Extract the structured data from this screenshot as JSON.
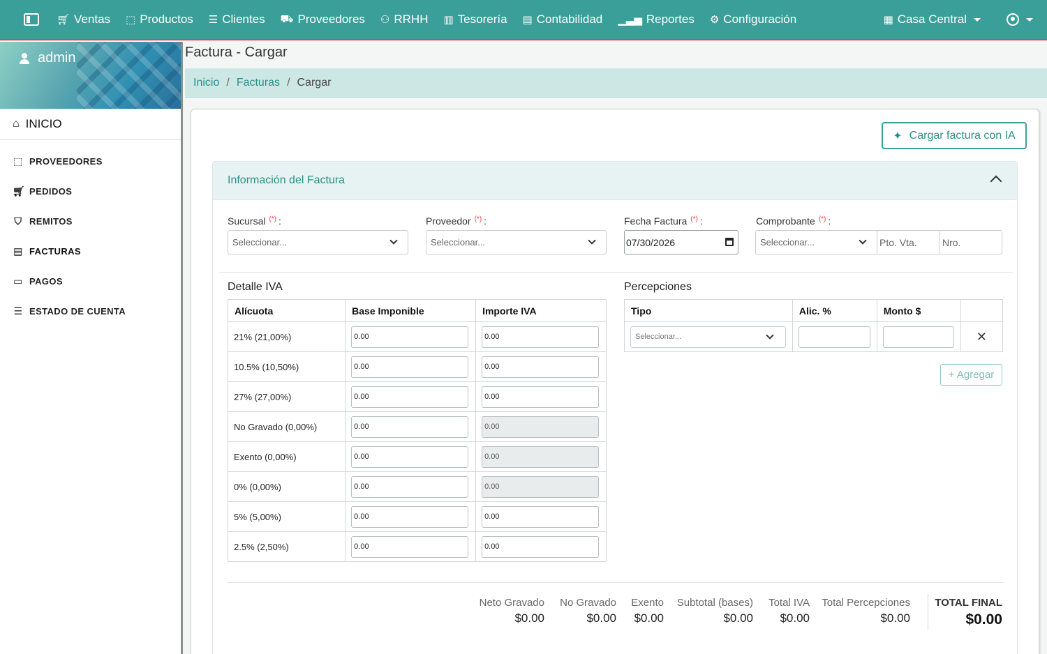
{
  "topnav": {
    "items": [
      {
        "icon": "cart-icon",
        "label": "Ventas"
      },
      {
        "icon": "box-icon",
        "label": "Productos"
      },
      {
        "icon": "users-icon",
        "label": "Clientes"
      },
      {
        "icon": "truck-icon",
        "label": "Proveedores"
      },
      {
        "icon": "people-icon",
        "label": "RRHH"
      },
      {
        "icon": "bank-icon",
        "label": "Tesorería"
      },
      {
        "icon": "ledger-icon",
        "label": "Contabilidad"
      },
      {
        "icon": "chart-icon",
        "label": "Reportes"
      },
      {
        "icon": "gear-icon",
        "label": "Configuración"
      }
    ],
    "branch": "Casa Central"
  },
  "sidebar": {
    "user": "admin",
    "home": "INICIO",
    "items": [
      {
        "label": "PROVEEDORES",
        "icon": "box-icon"
      },
      {
        "label": "PEDIDOS",
        "icon": "cart-icon"
      },
      {
        "label": "REMITOS",
        "icon": "basket-icon"
      },
      {
        "label": "FACTURAS",
        "icon": "invoice-icon"
      },
      {
        "label": "PAGOS",
        "icon": "cash-icon"
      },
      {
        "label": "ESTADO DE CUENTA",
        "icon": "document-icon"
      }
    ],
    "active": "FACTURAS"
  },
  "page": {
    "title": "Factura - Cargar",
    "breadcrumb": [
      "Inicio",
      "Facturas",
      "Cargar"
    ],
    "ai_button": "Cargar factura con IA"
  },
  "section": {
    "title": "Información del Factura",
    "fields": {
      "sucursal": {
        "label": "Sucursal",
        "placeholder": "Seleccionar..."
      },
      "proveedor": {
        "label": "Proveedor",
        "placeholder": "Seleccionar..."
      },
      "fecha": {
        "label": "Fecha Factura",
        "value": "07/30/2026"
      },
      "comprobante": {
        "label": "Comprobante",
        "placeholder": "Seleccionar...",
        "pto_vta": "Pto. Vta.",
        "nro": "Nro."
      },
      "required_mark": "(*)",
      "colon": ":"
    }
  },
  "iva": {
    "title": "Detalle IVA",
    "headers": [
      "Alícuota",
      "Base Imponible",
      "Importe IVA"
    ],
    "rows": [
      {
        "alicuota": "21% (21,00%)",
        "base": "0.00",
        "importe": "0.00",
        "readonly": false
      },
      {
        "alicuota": "10.5% (10,50%)",
        "base": "0.00",
        "importe": "0.00",
        "readonly": false
      },
      {
        "alicuota": "27% (27,00%)",
        "base": "0.00",
        "importe": "0.00",
        "readonly": false
      },
      {
        "alicuota": "No Gravado (0,00%)",
        "base": "0.00",
        "importe": "0.00",
        "readonly": true
      },
      {
        "alicuota": "Exento (0,00%)",
        "base": "0.00",
        "importe": "0.00",
        "readonly": true
      },
      {
        "alicuota": "0% (0,00%)",
        "base": "0.00",
        "importe": "0.00",
        "readonly": true
      },
      {
        "alicuota": "5% (5,00%)",
        "base": "0.00",
        "importe": "0.00",
        "readonly": false
      },
      {
        "alicuota": "2.5% (2,50%)",
        "base": "0.00",
        "importe": "0.00",
        "readonly": false
      }
    ]
  },
  "percepciones": {
    "title": "Percepciones",
    "headers": [
      "Tipo",
      "Alic. %",
      "Monto $"
    ],
    "row": {
      "tipo_placeholder": "Seleccionar...",
      "alic": "",
      "monto": ""
    },
    "add_button": "+ Agregar"
  },
  "totals": [
    {
      "label": "Neto Gravado",
      "value": "$0.00"
    },
    {
      "label": "No Gravado",
      "value": "$0.00"
    },
    {
      "label": "Exento",
      "value": "$0.00"
    },
    {
      "label": "Subtotal (bases)",
      "value": "$0.00"
    },
    {
      "label": "Total IVA",
      "value": "$0.00"
    },
    {
      "label": "Total Percepciones",
      "value": "$0.00"
    }
  ],
  "total_final": {
    "label": "TOTAL FINAL",
    "value": "$0.00"
  }
}
